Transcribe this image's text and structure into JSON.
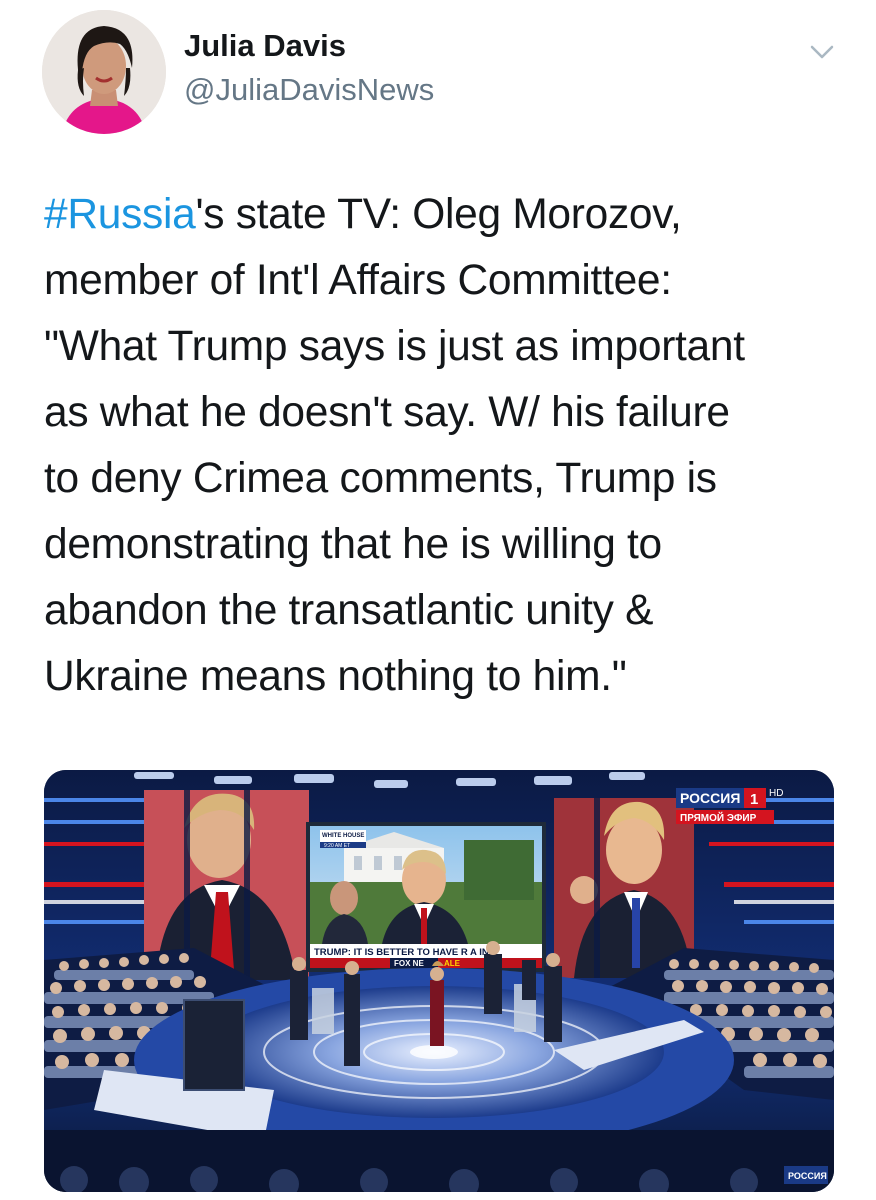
{
  "author": {
    "display_name": "Julia Davis",
    "handle": "@JuliaDavisNews",
    "avatar_icon": "profile-photo"
  },
  "menu": {
    "icon": "chevron-down-icon"
  },
  "tweet": {
    "hashtag": "#Russia",
    "line1_rest": "'s state TV: Oleg Morozov,",
    "line2": "member of Int'l Affairs Committee:",
    "line3": "\"What Trump says is just as important",
    "line4": "as what he doesn't say. W/ his failure",
    "line5": "to deny Crimea comments, Trump is",
    "line6": "demonstrating that he is willing to",
    "line7": "abandon the transatlantic unity &",
    "line8": "Ukraine means nothing to him.\""
  },
  "media": {
    "channel_name": "РОССИЯ",
    "channel_number": "1",
    "hd_label": "HD",
    "live_label": "ПРЯМОЙ ЭФИР",
    "screen_location_label": "WHITE HOUSE",
    "screen_time_label": "9:20 AM ET",
    "screen_lower_third": "TRUMP: IT IS BETTER TO HAVE R A IN",
    "screen_network_label": "FOX NE",
    "screen_alert_label": "ALE",
    "corner_watermark": "РОССИЯ",
    "colors": {
      "hashtag": "#1b95e0",
      "handle": "#657786",
      "studio_blue": "#1a3a86",
      "channel_red": "#d4141f"
    }
  }
}
